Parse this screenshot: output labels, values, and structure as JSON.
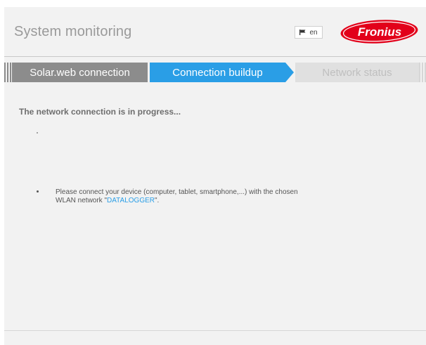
{
  "header": {
    "title": "System monitoring",
    "language_label": "en",
    "logo_text": "Fronius"
  },
  "steps": [
    {
      "label": "Solar.web connection",
      "state": "done"
    },
    {
      "label": "Connection buildup",
      "state": "active"
    },
    {
      "label": "Network status",
      "state": "pending"
    }
  ],
  "main": {
    "status": "The network connection is in progress...",
    "instruction_line1": "Please connect your device (computer, tablet, smartphone,...) with the chosen",
    "instruction_line2_prefix": "WLAN network \"",
    "network_name": "DATALOGGER",
    "instruction_line2_suffix": "\"."
  },
  "colors": {
    "accent": "#2a9ee6",
    "brand": "#e2001a",
    "step_done": "#8c8c8c",
    "step_pending": "#e0e0e0"
  }
}
